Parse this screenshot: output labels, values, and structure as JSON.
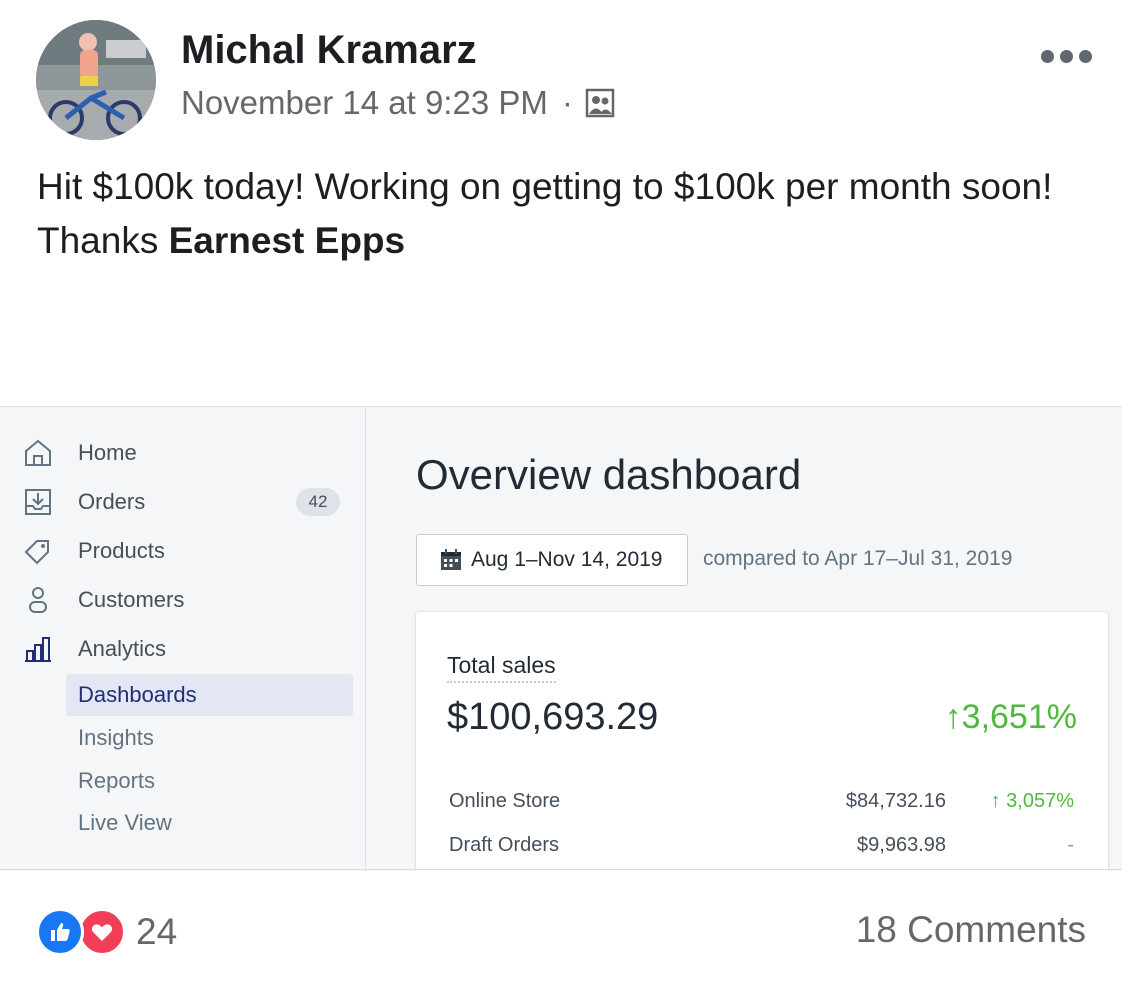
{
  "post": {
    "author": "Michal Kramarz",
    "timestamp": "November 14 at 9:23 PM",
    "separator": "·",
    "audience_icon": "friends-icon",
    "text_prefix": "Hit $100k today! Working on getting to $100k per month soon! Thanks ",
    "mention": "Earnest Epps"
  },
  "dashboard": {
    "sidebar": {
      "items": [
        {
          "label": "Home",
          "icon": "home-icon"
        },
        {
          "label": "Orders",
          "icon": "orders-icon",
          "badge": "42"
        },
        {
          "label": "Products",
          "icon": "tag-icon"
        },
        {
          "label": "Customers",
          "icon": "person-icon"
        },
        {
          "label": "Analytics",
          "icon": "bar-chart-icon"
        }
      ],
      "subitems": [
        {
          "label": "Dashboards",
          "active": true
        },
        {
          "label": "Insights"
        },
        {
          "label": "Reports"
        },
        {
          "label": "Live View"
        }
      ]
    },
    "title": "Overview dashboard",
    "date_range": "Aug 1–Nov 14, 2019",
    "compare": "compared to Apr 17–Jul 31, 2019",
    "card": {
      "title": "Total sales",
      "total": "$100,693.29",
      "change": "3,651%",
      "rows": [
        {
          "name": "Online Store",
          "amount": "$84,732.16",
          "change": "3,057%"
        },
        {
          "name": "Draft Orders",
          "amount": "$9,963.98",
          "change": "-"
        }
      ]
    },
    "colors": {
      "accent_green": "#50b83c",
      "active_nav": "#202e78"
    }
  },
  "footer": {
    "reaction_count": "24",
    "reaction_icons": [
      "like-icon",
      "love-icon"
    ],
    "comments": "18 Comments"
  }
}
